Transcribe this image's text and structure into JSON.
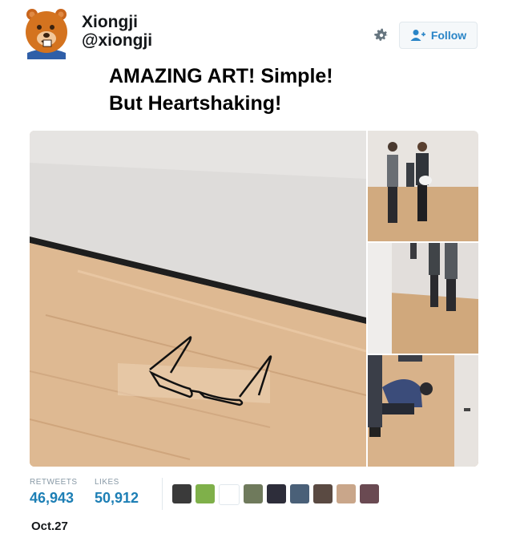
{
  "user": {
    "name": "Xiongji",
    "handle": "@xiongji",
    "avatar_icon": "bear-avatar-icon"
  },
  "actions": {
    "settings_icon": "gear-icon",
    "follow_label": "Follow",
    "follow_icon": "add-user-icon"
  },
  "tweet": {
    "line1": "AMAZING ART! Simple!",
    "line2": "But Heartshaking!"
  },
  "media": {
    "main_image": "eyeglasses-on-gallery-floor-photo",
    "thumbnails": [
      "visitors-looking-at-floor-photo",
      "visitors-walking-gallery-photo",
      "person-crouching-photographing-photo"
    ]
  },
  "stats": {
    "retweets_label": "RETWEETS",
    "retweets_value": "46,943",
    "likes_label": "LIKES",
    "likes_value": "50,912",
    "liker_avatars": [
      "#3a3a3a",
      "#7fb04a",
      "#ffffff",
      "#6f7a5c",
      "#2d2d3a",
      "#4a6078",
      "#5a4a42",
      "#c9a68a",
      "#6a4a52"
    ]
  },
  "date": "Oct.27",
  "colors": {
    "accent": "#1d7fb5",
    "follow_text": "#2a85c7",
    "muted": "#8899a6"
  }
}
